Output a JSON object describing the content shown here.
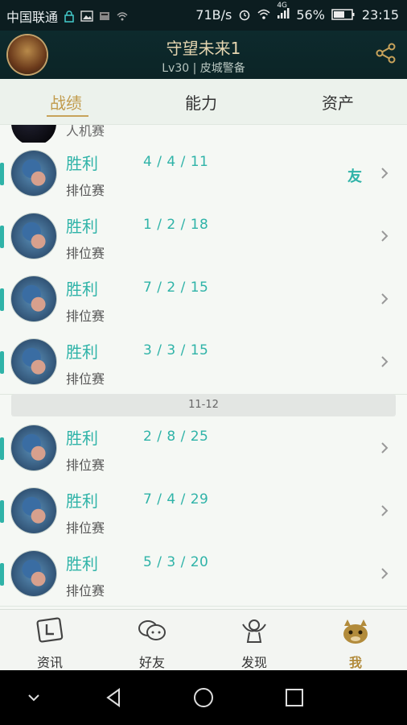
{
  "status_bar": {
    "carrier": "中国联通",
    "net_speed": "71B/s",
    "network_type": "4G",
    "battery": "56%",
    "time": "23:15"
  },
  "header": {
    "title": "守望未来1",
    "subtitle": "Lv30 | 皮城警备"
  },
  "tabs": [
    "战绩",
    "能力",
    "资产"
  ],
  "partial_row": {
    "mode": "人机赛"
  },
  "matches_group1": [
    {
      "result": "胜利",
      "kda": "4 / 4 / 11",
      "mode": "排位赛",
      "friend": "友"
    },
    {
      "result": "胜利",
      "kda": "1 / 2 / 18",
      "mode": "排位赛",
      "friend": ""
    },
    {
      "result": "胜利",
      "kda": "7 / 2 / 15",
      "mode": "排位赛",
      "friend": ""
    },
    {
      "result": "胜利",
      "kda": "3 / 3 / 15",
      "mode": "排位赛",
      "friend": ""
    }
  ],
  "date_separator": "11-12",
  "matches_group2": [
    {
      "result": "胜利",
      "kda": "2 / 8 / 25",
      "mode": "排位赛",
      "friend": ""
    },
    {
      "result": "胜利",
      "kda": "7 / 4 / 29",
      "mode": "排位赛",
      "friend": ""
    },
    {
      "result": "胜利",
      "kda": "5 / 3 / 20",
      "mode": "排位赛",
      "friend": ""
    }
  ],
  "bottom_nav": [
    {
      "label": "资讯",
      "icon": "news-icon"
    },
    {
      "label": "好友",
      "icon": "chat-bubbles-icon"
    },
    {
      "label": "发现",
      "icon": "compass-mascot-icon"
    },
    {
      "label": "我",
      "icon": "poro-icon"
    }
  ],
  "colors": {
    "accent": "#2fb3a8",
    "gold": "#c19b4c",
    "header_bg": "#0c2426"
  }
}
